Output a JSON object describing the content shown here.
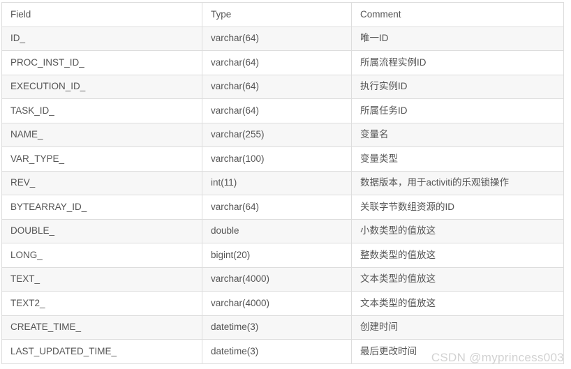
{
  "table": {
    "columns": [
      "Field",
      "Type",
      "Comment"
    ],
    "rows": [
      {
        "field": "ID_",
        "type": "varchar(64)",
        "comment": "唯一ID"
      },
      {
        "field": "PROC_INST_ID_",
        "type": "varchar(64)",
        "comment": "所属流程实例ID"
      },
      {
        "field": "EXECUTION_ID_",
        "type": "varchar(64)",
        "comment": "执行实例ID"
      },
      {
        "field": "TASK_ID_",
        "type": "varchar(64)",
        "comment": "所属任务ID"
      },
      {
        "field": "NAME_",
        "type": "varchar(255)",
        "comment": "变量名"
      },
      {
        "field": "VAR_TYPE_",
        "type": "varchar(100)",
        "comment": "变量类型"
      },
      {
        "field": "REV_",
        "type": "int(11)",
        "comment": "数据版本，用于activiti的乐观锁操作"
      },
      {
        "field": "BYTEARRAY_ID_",
        "type": "varchar(64)",
        "comment": "关联字节数组资源的ID"
      },
      {
        "field": "DOUBLE_",
        "type": "double",
        "comment": "小数类型的值放这"
      },
      {
        "field": "LONG_",
        "type": "bigint(20)",
        "comment": "整数类型的值放这"
      },
      {
        "field": "TEXT_",
        "type": "varchar(4000)",
        "comment": "文本类型的值放这"
      },
      {
        "field": "TEXT2_",
        "type": "varchar(4000)",
        "comment": "文本类型的值放这"
      },
      {
        "field": "CREATE_TIME_",
        "type": "datetime(3)",
        "comment": "创建时间"
      },
      {
        "field": "LAST_UPDATED_TIME_",
        "type": "datetime(3)",
        "comment": "最后更改时间"
      }
    ]
  },
  "watermark": {
    "text": "CSDN @myprincess003"
  },
  "colors": {
    "border": "#dddddd",
    "text": "#555555",
    "row_alt_background": "#f7f7f7",
    "row_background": "#ffffff",
    "watermark": "#d2d2d2"
  }
}
